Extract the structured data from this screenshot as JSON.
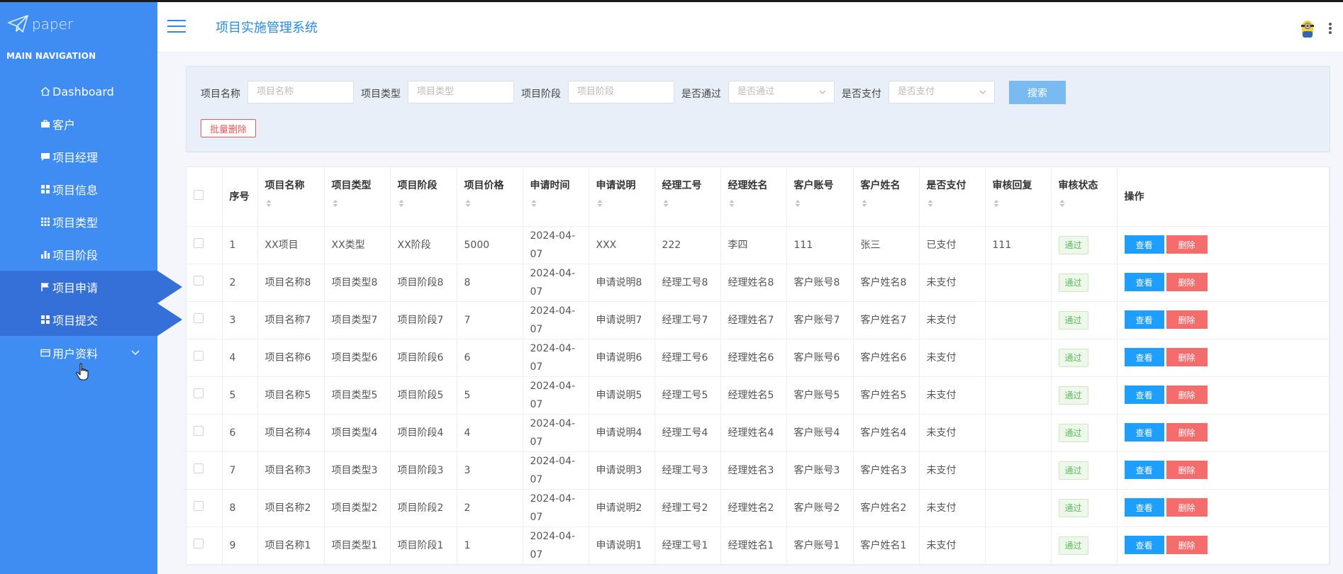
{
  "sidebar": {
    "logo_text": "paper",
    "nav_header": "MAIN NAVIGATION",
    "items": [
      {
        "label": "Dashboard",
        "icon": "home-icon"
      },
      {
        "label": "客户",
        "icon": "briefcase-icon"
      },
      {
        "label": "项目经理",
        "icon": "comment-icon"
      },
      {
        "label": "项目信息",
        "icon": "grid-icon"
      },
      {
        "label": "项目类型",
        "icon": "apps-icon"
      },
      {
        "label": "项目阶段",
        "icon": "bar-chart-icon"
      },
      {
        "label": "项目申请",
        "icon": "flag-icon"
      },
      {
        "label": "项目提交",
        "icon": "grid-icon"
      },
      {
        "label": "用户资料",
        "icon": "id-card-icon"
      }
    ]
  },
  "header": {
    "title": "项目实施管理系统"
  },
  "search": {
    "name_label": "项目名称",
    "name_placeholder": "项目名称",
    "type_label": "项目类型",
    "type_placeholder": "项目类型",
    "stage_label": "项目阶段",
    "stage_placeholder": "项目阶段",
    "passed_label": "是否通过",
    "passed_placeholder": "是否通过",
    "paid_label": "是否支付",
    "paid_placeholder": "是否支付",
    "search_button": "搜索",
    "batch_delete_button": "批量删除"
  },
  "table": {
    "columns": [
      "序号",
      "项目名称",
      "项目类型",
      "项目阶段",
      "项目价格",
      "申请时间",
      "申请说明",
      "经理工号",
      "经理姓名",
      "客户账号",
      "客户姓名",
      "是否支付",
      "审核回复",
      "审核状态",
      "操作"
    ],
    "view_label": "查看",
    "delete_label": "删除",
    "rows": [
      {
        "no": "1",
        "name": "XX项目",
        "type": "XX类型",
        "stage": "XX阶段",
        "price": "5000",
        "time": "2024-04-07",
        "desc": "XXX",
        "mgr_no": "222",
        "mgr_name": "李四",
        "cust_acct": "111",
        "cust_name": "张三",
        "paid": "已支付",
        "reply": "111",
        "status": "通过"
      },
      {
        "no": "2",
        "name": "项目名称8",
        "type": "项目类型8",
        "stage": "项目阶段8",
        "price": "8",
        "time": "2024-04-07",
        "desc": "申请说明8",
        "mgr_no": "经理工号8",
        "mgr_name": "经理姓名8",
        "cust_acct": "客户账号8",
        "cust_name": "客户姓名8",
        "paid": "未支付",
        "reply": "",
        "status": "通过"
      },
      {
        "no": "3",
        "name": "项目名称7",
        "type": "项目类型7",
        "stage": "项目阶段7",
        "price": "7",
        "time": "2024-04-07",
        "desc": "申请说明7",
        "mgr_no": "经理工号7",
        "mgr_name": "经理姓名7",
        "cust_acct": "客户账号7",
        "cust_name": "客户姓名7",
        "paid": "未支付",
        "reply": "",
        "status": "通过"
      },
      {
        "no": "4",
        "name": "项目名称6",
        "type": "项目类型6",
        "stage": "项目阶段6",
        "price": "6",
        "time": "2024-04-07",
        "desc": "申请说明6",
        "mgr_no": "经理工号6",
        "mgr_name": "经理姓名6",
        "cust_acct": "客户账号6",
        "cust_name": "客户姓名6",
        "paid": "未支付",
        "reply": "",
        "status": "通过"
      },
      {
        "no": "5",
        "name": "项目名称5",
        "type": "项目类型5",
        "stage": "项目阶段5",
        "price": "5",
        "time": "2024-04-07",
        "desc": "申请说明5",
        "mgr_no": "经理工号5",
        "mgr_name": "经理姓名5",
        "cust_acct": "客户账号5",
        "cust_name": "客户姓名5",
        "paid": "未支付",
        "reply": "",
        "status": "通过"
      },
      {
        "no": "6",
        "name": "项目名称4",
        "type": "项目类型4",
        "stage": "项目阶段4",
        "price": "4",
        "time": "2024-04-07",
        "desc": "申请说明4",
        "mgr_no": "经理工号4",
        "mgr_name": "经理姓名4",
        "cust_acct": "客户账号4",
        "cust_name": "客户姓名4",
        "paid": "未支付",
        "reply": "",
        "status": "通过"
      },
      {
        "no": "7",
        "name": "项目名称3",
        "type": "项目类型3",
        "stage": "项目阶段3",
        "price": "3",
        "time": "2024-04-07",
        "desc": "申请说明3",
        "mgr_no": "经理工号3",
        "mgr_name": "经理姓名3",
        "cust_acct": "客户账号3",
        "cust_name": "客户姓名3",
        "paid": "未支付",
        "reply": "",
        "status": "通过"
      },
      {
        "no": "8",
        "name": "项目名称2",
        "type": "项目类型2",
        "stage": "项目阶段2",
        "price": "2",
        "time": "2024-04-07",
        "desc": "申请说明2",
        "mgr_no": "经理工号2",
        "mgr_name": "经理姓名2",
        "cust_acct": "客户账号2",
        "cust_name": "客户姓名2",
        "paid": "未支付",
        "reply": "",
        "status": "通过"
      },
      {
        "no": "9",
        "name": "项目名称1",
        "type": "项目类型1",
        "stage": "项目阶段1",
        "price": "1",
        "time": "2024-04-07",
        "desc": "申请说明1",
        "mgr_no": "经理工号1",
        "mgr_name": "经理姓名1",
        "cust_acct": "客户账号1",
        "cust_name": "客户姓名1",
        "paid": "未支付",
        "reply": "",
        "status": "通过"
      }
    ]
  },
  "colors": {
    "sidebar_bg": "#3f8cf2",
    "sidebar_active": "#3470d8",
    "accent": "#2a8ae6",
    "view_button": "#1e9fff",
    "delete_button": "#f56c6c",
    "status_pass": "#5cb85c"
  }
}
